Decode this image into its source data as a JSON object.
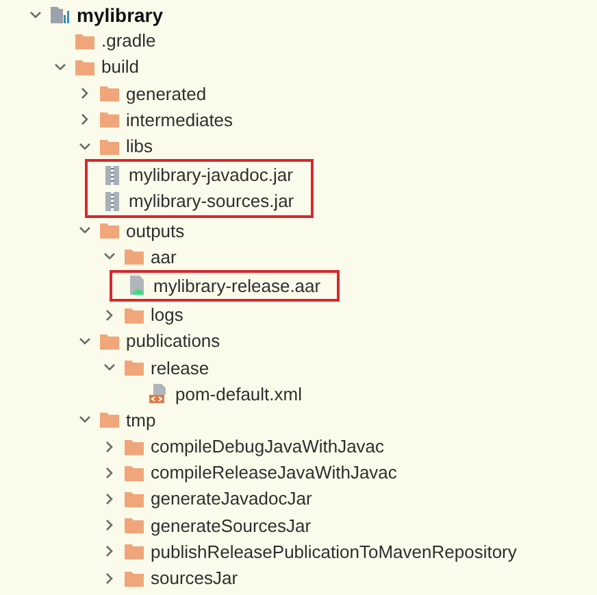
{
  "tree": {
    "label": "mylibrary",
    "kind": "module",
    "expanded": true,
    "children": [
      {
        "label": ".gradle",
        "kind": "folder"
      },
      {
        "label": "build",
        "kind": "folder",
        "expanded": true,
        "children": [
          {
            "label": "generated",
            "kind": "folder",
            "expanded": false
          },
          {
            "label": "intermediates",
            "kind": "folder",
            "expanded": false
          },
          {
            "label": "libs",
            "kind": "folder",
            "expanded": true,
            "highlighted_children": true,
            "children": [
              {
                "label": "mylibrary-javadoc.jar",
                "kind": "jar"
              },
              {
                "label": "mylibrary-sources.jar",
                "kind": "jar"
              }
            ]
          },
          {
            "label": "outputs",
            "kind": "folder",
            "expanded": true,
            "children": [
              {
                "label": "aar",
                "kind": "folder",
                "expanded": true,
                "highlighted_children": true,
                "children": [
                  {
                    "label": "mylibrary-release.aar",
                    "kind": "aar"
                  }
                ]
              },
              {
                "label": "logs",
                "kind": "folder",
                "expanded": false
              }
            ]
          },
          {
            "label": "publications",
            "kind": "folder",
            "expanded": true,
            "children": [
              {
                "label": "release",
                "kind": "folder",
                "expanded": true,
                "children": [
                  {
                    "label": "pom-default.xml",
                    "kind": "xml"
                  }
                ]
              }
            ]
          },
          {
            "label": "tmp",
            "kind": "folder",
            "expanded": true,
            "children": [
              {
                "label": "compileDebugJavaWithJavac",
                "kind": "folder",
                "expanded": false
              },
              {
                "label": "compileReleaseJavaWithJavac",
                "kind": "folder",
                "expanded": false
              },
              {
                "label": "generateJavadocJar",
                "kind": "folder",
                "expanded": false
              },
              {
                "label": "generateSourcesJar",
                "kind": "folder",
                "expanded": false
              },
              {
                "label": "publishReleasePublicationToMavenRepository",
                "kind": "folder",
                "expanded": false
              },
              {
                "label": "sourcesJar",
                "kind": "folder",
                "expanded": false
              }
            ]
          }
        ]
      }
    ]
  }
}
